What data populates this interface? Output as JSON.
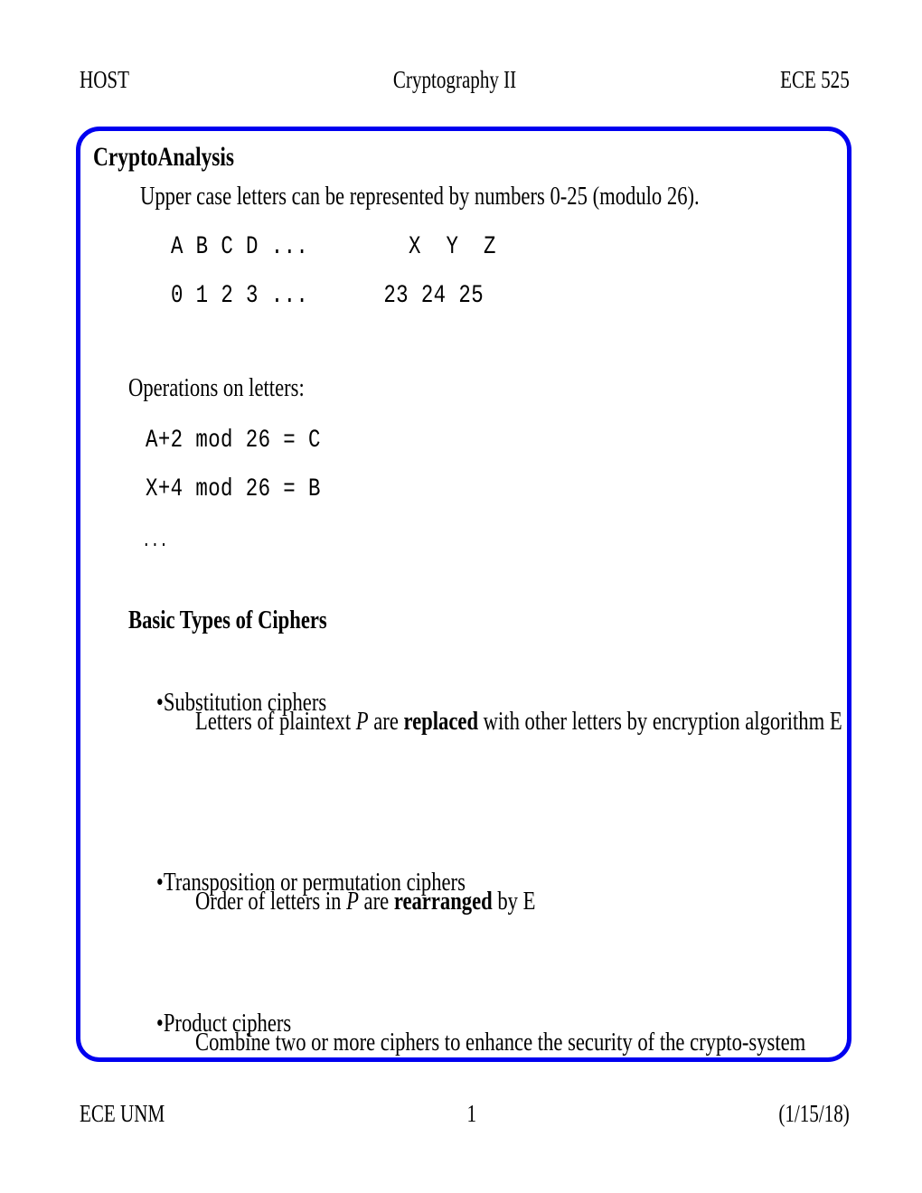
{
  "header": {
    "left": "HOST",
    "center": "Cryptography II",
    "right": "ECE 525"
  },
  "slide": {
    "title": "CryptoAnalysis",
    "intro": "Upper case letters can be represented by numbers 0-25 (modulo 26).",
    "alphabet_table": {
      "letters_row": "A B C D ...        X  Y  Z",
      "numbers_row": "0 1 2 3 ...      23 24 25"
    },
    "operations_heading": "Operations on letters:",
    "operations": [
      "A+2 mod 26 = C",
      "X+4 mod 26 = B"
    ],
    "operations_ellipsis": "...",
    "ciphers_heading": "Basic Types of Ciphers",
    "cipher_items": [
      {
        "bullet": "•",
        "label": "Substitution ciphers",
        "detail_pre": "Letters of plaintext ",
        "detail_italic": "P",
        "detail_mid": " are ",
        "detail_bold": "replaced",
        "detail_post": " with other letters by encryption algorithm E"
      },
      {
        "bullet": "•",
        "label": "Transposition or permutation ciphers",
        "detail_pre": "Order of letters in ",
        "detail_italic": "P",
        "detail_mid": " are ",
        "detail_bold": "rearranged",
        "detail_post": " by E"
      },
      {
        "bullet": "•",
        "label": "Product ciphers",
        "detail_pre": "Combine two or more ciphers to enhance the security of the crypto-system",
        "detail_italic": "",
        "detail_mid": "",
        "detail_bold": "",
        "detail_post": ""
      }
    ]
  },
  "footer": {
    "left": "ECE UNM",
    "center": "1",
    "right": "(1/15/18)"
  },
  "colors": {
    "border": "#0000f0",
    "text": "#000000",
    "background": "#ffffff"
  }
}
